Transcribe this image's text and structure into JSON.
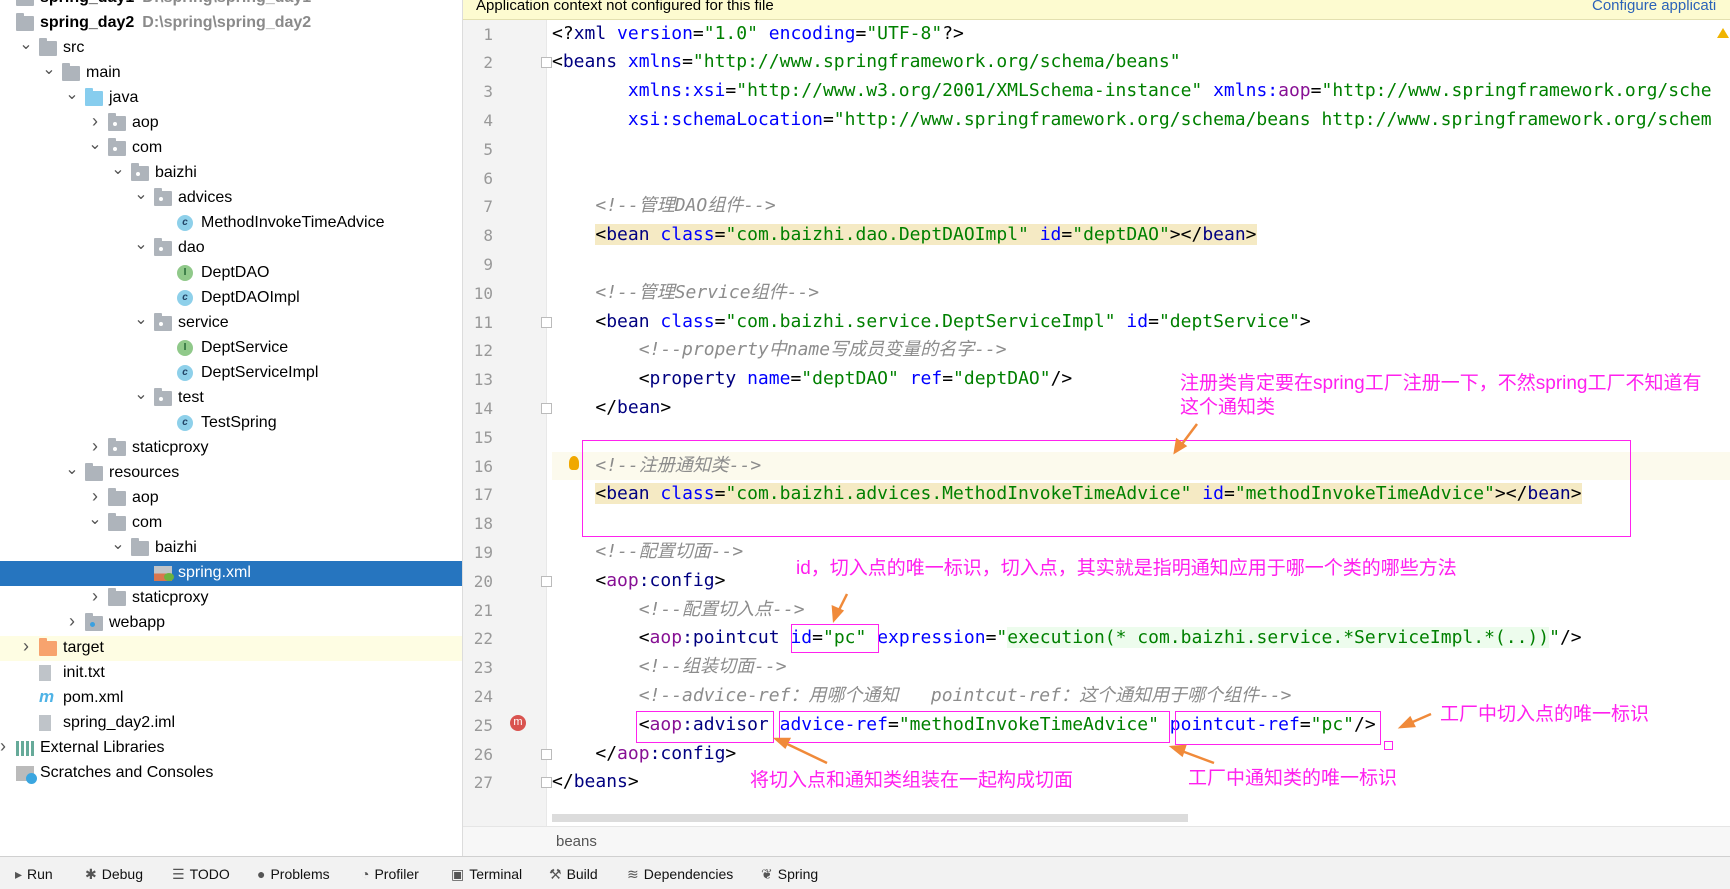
{
  "project_tree": {
    "items": [
      {
        "label": "spring_day1",
        "path": "D:\\spring\\spring_day1",
        "level": 0,
        "chevron": "none",
        "icon": "module-icon",
        "bold": true
      },
      {
        "label": "spring_day2",
        "path": "D:\\spring\\spring_day2",
        "level": 0,
        "chevron": "none",
        "icon": "module-icon",
        "bold": true
      },
      {
        "label": "src",
        "level": 1,
        "chevron": "open",
        "icon": "folder-icon"
      },
      {
        "label": "main",
        "level": 2,
        "chevron": "open",
        "icon": "folder-icon"
      },
      {
        "label": "java",
        "level": 3,
        "chevron": "open",
        "icon": "source-folder-icon"
      },
      {
        "label": "aop",
        "level": 4,
        "chevron": "closed",
        "icon": "package-icon"
      },
      {
        "label": "com",
        "level": 4,
        "chevron": "open",
        "icon": "package-icon"
      },
      {
        "label": "baizhi",
        "level": 5,
        "chevron": "open",
        "icon": "package-icon"
      },
      {
        "label": "advices",
        "level": 6,
        "chevron": "open",
        "icon": "package-icon"
      },
      {
        "label": "MethodInvokeTimeAdvice",
        "level": 7,
        "chevron": "none",
        "icon": "class-icon"
      },
      {
        "label": "dao",
        "level": 6,
        "chevron": "open",
        "icon": "package-icon"
      },
      {
        "label": "DeptDAO",
        "level": 7,
        "chevron": "none",
        "icon": "interface-icon"
      },
      {
        "label": "DeptDAOImpl",
        "level": 7,
        "chevron": "none",
        "icon": "class-icon"
      },
      {
        "label": "service",
        "level": 6,
        "chevron": "open",
        "icon": "package-icon"
      },
      {
        "label": "DeptService",
        "level": 7,
        "chevron": "none",
        "icon": "interface-icon"
      },
      {
        "label": "DeptServiceImpl",
        "level": 7,
        "chevron": "none",
        "icon": "class-icon"
      },
      {
        "label": "test",
        "level": 6,
        "chevron": "open",
        "icon": "package-icon"
      },
      {
        "label": "TestSpring",
        "level": 7,
        "chevron": "none",
        "icon": "class-icon"
      },
      {
        "label": "staticproxy",
        "level": 4,
        "chevron": "closed",
        "icon": "package-icon"
      },
      {
        "label": "resources",
        "level": 3,
        "chevron": "open",
        "icon": "resources-folder-icon"
      },
      {
        "label": "aop",
        "level": 4,
        "chevron": "closed",
        "icon": "folder-icon"
      },
      {
        "label": "com",
        "level": 4,
        "chevron": "open",
        "icon": "folder-icon"
      },
      {
        "label": "baizhi",
        "level": 5,
        "chevron": "open",
        "icon": "folder-icon"
      },
      {
        "label": "spring.xml",
        "level": 6,
        "chevron": "none",
        "icon": "spring-xml-icon",
        "selected": true
      },
      {
        "label": "staticproxy",
        "level": 4,
        "chevron": "closed",
        "icon": "folder-icon"
      },
      {
        "label": "webapp",
        "level": 3,
        "chevron": "closed",
        "icon": "web-folder-icon"
      },
      {
        "label": "target",
        "level": 1,
        "chevron": "closed",
        "icon": "excluded-folder-icon",
        "highlighted": true
      },
      {
        "label": "init.txt",
        "level": 1,
        "chevron": "none",
        "icon": "text-file-icon"
      },
      {
        "label": "pom.xml",
        "level": 1,
        "chevron": "none",
        "icon": "maven-icon"
      },
      {
        "label": "spring_day2.iml",
        "level": 1,
        "chevron": "none",
        "icon": "iml-file-icon"
      },
      {
        "label": "External Libraries",
        "level": 0,
        "chevron": "closed",
        "icon": "libraries-icon"
      },
      {
        "label": "Scratches and Consoles",
        "level": 0,
        "chevron": "none",
        "icon": "scratches-icon"
      }
    ]
  },
  "editor": {
    "banner_text": "Application context not configured for this file",
    "banner_link": "Configure applicati",
    "current_line": 16,
    "lines": [
      {
        "n": 1,
        "tokens": [
          [
            "p",
            "<?"
          ],
          [
            "t",
            "xml"
          ],
          [
            "p",
            " "
          ],
          [
            "a",
            "version"
          ],
          [
            "p",
            "="
          ],
          [
            "v",
            "\"1.0\""
          ],
          [
            "p",
            " "
          ],
          [
            "a",
            "encoding"
          ],
          [
            "p",
            "="
          ],
          [
            "v",
            "\"UTF-8\""
          ],
          [
            "p",
            "?>"
          ]
        ]
      },
      {
        "n": 2,
        "tokens": [
          [
            "p",
            "<"
          ],
          [
            "t",
            "beans"
          ],
          [
            "p",
            " "
          ],
          [
            "a",
            "xmlns"
          ],
          [
            "p",
            "="
          ],
          [
            "v",
            "\"http://www.springframework.org/schema/beans\""
          ]
        ]
      },
      {
        "n": 3,
        "tokens": [
          [
            "p",
            "       "
          ],
          [
            "a",
            "xmlns:xsi"
          ],
          [
            "p",
            "="
          ],
          [
            "v",
            "\"http://www.w3.org/2001/XMLSchema-instance\""
          ],
          [
            "p",
            " "
          ],
          [
            "a",
            "xmlns:"
          ],
          [
            "n",
            "aop"
          ],
          [
            "p",
            "="
          ],
          [
            "v",
            "\"http://www.springframework.org/sche"
          ]
        ]
      },
      {
        "n": 4,
        "tokens": [
          [
            "p",
            "       "
          ],
          [
            "a",
            "xsi:schemaLocation"
          ],
          [
            "p",
            "="
          ],
          [
            "v",
            "\"http://www.springframework.org/schema/beans http://www.springframework.org/schem"
          ]
        ]
      },
      {
        "n": 5,
        "tokens": []
      },
      {
        "n": 6,
        "tokens": []
      },
      {
        "n": 7,
        "tokens": [
          [
            "p",
            "    "
          ],
          [
            "c",
            "<!--管理DAO组件-->"
          ]
        ]
      },
      {
        "n": 8,
        "highlight": true,
        "tokens": [
          [
            "p",
            "    "
          ],
          [
            "p",
            "<"
          ],
          [
            "t",
            "bean"
          ],
          [
            "p",
            " "
          ],
          [
            "a",
            "class"
          ],
          [
            "p",
            "="
          ],
          [
            "v",
            "\"com.baizhi.dao.DeptDAOImpl\""
          ],
          [
            "p",
            " "
          ],
          [
            "a",
            "id"
          ],
          [
            "p",
            "="
          ],
          [
            "v",
            "\"deptDAO\""
          ],
          [
            "p",
            "></"
          ],
          [
            "t",
            "bean"
          ],
          [
            "p",
            ">"
          ]
        ]
      },
      {
        "n": 9,
        "tokens": []
      },
      {
        "n": 10,
        "tokens": [
          [
            "p",
            "    "
          ],
          [
            "c",
            "<!--管理Service组件-->"
          ]
        ]
      },
      {
        "n": 11,
        "tokens": [
          [
            "p",
            "    "
          ],
          [
            "p",
            "<"
          ],
          [
            "t",
            "bean"
          ],
          [
            "p",
            " "
          ],
          [
            "a",
            "class"
          ],
          [
            "p",
            "="
          ],
          [
            "v",
            "\"com.baizhi.service.DeptServiceImpl\""
          ],
          [
            "p",
            " "
          ],
          [
            "a",
            "id"
          ],
          [
            "p",
            "="
          ],
          [
            "v",
            "\"deptService\""
          ],
          [
            "p",
            ">"
          ]
        ]
      },
      {
        "n": 12,
        "tokens": [
          [
            "p",
            "        "
          ],
          [
            "c",
            "<!--property中name写成员变量的名字-->"
          ]
        ]
      },
      {
        "n": 13,
        "tokens": [
          [
            "p",
            "        "
          ],
          [
            "p",
            "<"
          ],
          [
            "t",
            "property"
          ],
          [
            "p",
            " "
          ],
          [
            "a",
            "name"
          ],
          [
            "p",
            "="
          ],
          [
            "v",
            "\"deptDAO\""
          ],
          [
            "p",
            " "
          ],
          [
            "a",
            "ref"
          ],
          [
            "p",
            "="
          ],
          [
            "v",
            "\"deptDAO\""
          ],
          [
            "p",
            "/>"
          ]
        ]
      },
      {
        "n": 14,
        "tokens": [
          [
            "p",
            "    "
          ],
          [
            "p",
            "</"
          ],
          [
            "t",
            "bean"
          ],
          [
            "p",
            ">"
          ]
        ]
      },
      {
        "n": 15,
        "tokens": []
      },
      {
        "n": 16,
        "tokens": [
          [
            "p",
            "    "
          ],
          [
            "c",
            "<!--注册通知类-->"
          ]
        ]
      },
      {
        "n": 17,
        "highlight": true,
        "tokens": [
          [
            "p",
            "    "
          ],
          [
            "p",
            "<"
          ],
          [
            "t",
            "bean"
          ],
          [
            "p",
            " "
          ],
          [
            "a",
            "class"
          ],
          [
            "p",
            "="
          ],
          [
            "v",
            "\"com.baizhi.advices.MethodInvokeTimeAdvice\""
          ],
          [
            "p",
            " "
          ],
          [
            "a",
            "id"
          ],
          [
            "p",
            "="
          ],
          [
            "v",
            "\"methodInvokeTimeAdvice\""
          ],
          [
            "p",
            "></"
          ],
          [
            "t",
            "bean"
          ],
          [
            "p",
            ">"
          ]
        ]
      },
      {
        "n": 18,
        "tokens": []
      },
      {
        "n": 19,
        "tokens": [
          [
            "p",
            "    "
          ],
          [
            "c",
            "<!--配置切面-->"
          ]
        ]
      },
      {
        "n": 20,
        "tokens": [
          [
            "p",
            "    "
          ],
          [
            "p",
            "<"
          ],
          [
            "n",
            "aop"
          ],
          [
            "t",
            ":config"
          ],
          [
            "p",
            ">"
          ]
        ]
      },
      {
        "n": 21,
        "tokens": [
          [
            "p",
            "        "
          ],
          [
            "c",
            "<!--配置切入点-->"
          ]
        ]
      },
      {
        "n": 22,
        "tokens": [
          [
            "p",
            "        "
          ],
          [
            "p",
            "<"
          ],
          [
            "n",
            "aop"
          ],
          [
            "t",
            ":pointcut"
          ],
          [
            "p",
            " "
          ],
          [
            "a",
            "id"
          ],
          [
            "p",
            "="
          ],
          [
            "v",
            "\"pc\""
          ],
          [
            "p",
            " "
          ],
          [
            "a",
            "expression"
          ],
          [
            "p",
            "="
          ],
          [
            "v",
            "\""
          ],
          [
            "vg",
            "execution(* com.baizhi.service.*ServiceImpl.*(..))"
          ],
          [
            "v",
            "\""
          ],
          [
            "p",
            "/>"
          ]
        ]
      },
      {
        "n": 23,
        "tokens": [
          [
            "p",
            "        "
          ],
          [
            "c",
            "<!--组装切面-->"
          ]
        ]
      },
      {
        "n": 24,
        "tokens": [
          [
            "p",
            "        "
          ],
          [
            "c",
            "<!--advice-ref：用哪个通知   pointcut-ref：这个通知用于哪个组件-->"
          ]
        ]
      },
      {
        "n": 25,
        "tokens": [
          [
            "p",
            "        "
          ],
          [
            "p",
            "<"
          ],
          [
            "n",
            "aop"
          ],
          [
            "t",
            ":advisor"
          ],
          [
            "p",
            " "
          ],
          [
            "a",
            "advice-ref"
          ],
          [
            "p",
            "="
          ],
          [
            "v",
            "\"methodInvokeTimeAdvice\""
          ],
          [
            "p",
            " "
          ],
          [
            "a",
            "pointcut-ref"
          ],
          [
            "p",
            "="
          ],
          [
            "v",
            "\"pc\""
          ],
          [
            "p",
            "/>"
          ]
        ]
      },
      {
        "n": 26,
        "tokens": [
          [
            "p",
            "    "
          ],
          [
            "p",
            "</"
          ],
          [
            "n",
            "aop"
          ],
          [
            "t",
            ":config"
          ],
          [
            "p",
            ">"
          ]
        ]
      },
      {
        "n": 27,
        "tokens": [
          [
            "p",
            "</"
          ],
          [
            "t",
            "beans"
          ],
          [
            "p",
            ">"
          ]
        ]
      }
    ]
  },
  "annotations": {
    "register_note": "注册类肯定要在spring工厂注册一下，不然spring工厂不知道有这个通知类",
    "id_note": "id，切入点的唯一标识，切入点，其实就是指明通知应用于哪一个类的哪些方法",
    "pointcut_ref_note": "工厂中切入点的唯一标识",
    "advisor_note": "将切入点和通知类组装在一起构成切面",
    "advice_ref_note": "工厂中通知类的唯一标识",
    "box_color": "#ff22ee",
    "arrow_color": "#f08a3a"
  },
  "breadcrumb": {
    "item": "beans"
  },
  "toolbar": {
    "items": [
      {
        "label": "Run",
        "icon": "run-icon"
      },
      {
        "label": "Debug",
        "icon": "bug-icon"
      },
      {
        "label": "TODO",
        "icon": "list-icon"
      },
      {
        "label": "Problems",
        "icon": "problems-icon"
      },
      {
        "label": "Profiler",
        "icon": "profiler-icon"
      },
      {
        "label": "Terminal",
        "icon": "terminal-icon"
      },
      {
        "label": "Build",
        "icon": "hammer-icon"
      },
      {
        "label": "Dependencies",
        "icon": "dependencies-icon"
      },
      {
        "label": "Spring",
        "icon": "spring-leaf-icon"
      }
    ]
  }
}
